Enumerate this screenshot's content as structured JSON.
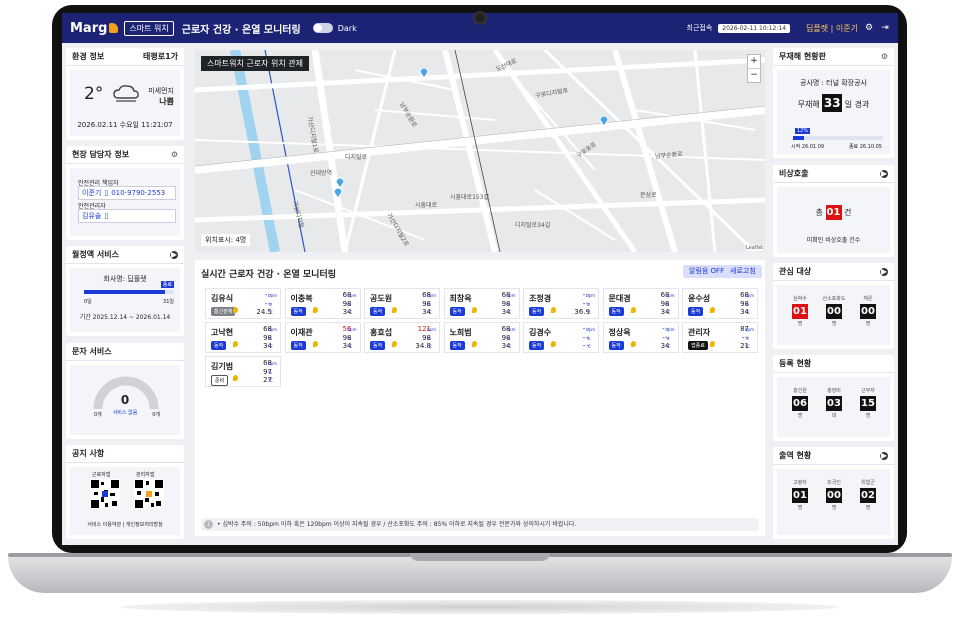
{
  "header": {
    "logo": "Marg",
    "tag": "스마트 워치",
    "title": "근로자 건강 · 온열 모니터링",
    "dark_label": "Dark",
    "last_access_label": "최근접속",
    "last_access_time": "2026-02-11 10:12:14",
    "user": "딥플렛",
    "sep": "|",
    "user2": "이준기"
  },
  "env": {
    "title": "환경 정보",
    "location": "태평로1가",
    "temp": "2°",
    "dust_label": "미세먼지",
    "dust_value": "나쁨",
    "datetime": "2026.02.11 수요일 11:21:07"
  },
  "manager": {
    "title": "현장 담당자 정보",
    "role1": "안전관리 책임자",
    "name1": "이준기",
    "phone1": "010-9790-2553",
    "role2": "안전관리자",
    "name2": "김유술"
  },
  "monthly": {
    "title": "월정액 서비스",
    "company": "회사명: 딥플렛",
    "badge": "종료",
    "start": "0일",
    "end": "31일",
    "progress": 0.9,
    "period": "기간 2025.12.14 ~ 2026.01.14"
  },
  "sms": {
    "title": "문자 서비스",
    "value": "0",
    "min": "0개",
    "max": "0개",
    "label": "서비스 없음"
  },
  "notice": {
    "title": "공지 사항",
    "qr1": "근로자앱",
    "qr2": "관리자앱",
    "links": "서비스 이용약관 | 개인정보처리방침"
  },
  "map": {
    "label": "스마트워치 근로자 위치 관제",
    "count": "위치표시: 4명",
    "zoom_in": "+",
    "zoom_out": "−",
    "attribution": "Leaflet",
    "streets": [
      "도산대로",
      "구로디지털로",
      "남부순환로",
      "가산디지털1로",
      "디지털로",
      "시흥대로",
      "구로동로",
      "신대방역",
      "가산디지털",
      "가산디지털2로",
      "남부순환로",
      "문성로",
      "시흥대로153길",
      "디지털로34길"
    ]
  },
  "monitor": {
    "title": "실시간 근로자 건강 · 온열 모니터링",
    "alarm_btn": "알림음 OFF",
    "refresh_btn": "새로고침",
    "units": {
      "bpm": "bpm",
      "pct": "%",
      "temp": "°C"
    },
    "workers": [
      {
        "name": "김유식",
        "status": "통신장애",
        "color": "#7b7f86",
        "hr": "- -",
        "o2": "- -",
        "temp": "24.5"
      },
      {
        "name": "이충복",
        "status": "동작",
        "color": "#1c3bd6",
        "hr": "68",
        "o2": "98",
        "temp": "34"
      },
      {
        "name": "공도원",
        "status": "동작",
        "color": "#1c3bd6",
        "hr": "68",
        "o2": "98",
        "temp": "34"
      },
      {
        "name": "최창옥",
        "status": "동작",
        "color": "#1c3bd6",
        "hr": "68",
        "o2": "98",
        "temp": "34"
      },
      {
        "name": "조정경",
        "status": "동작",
        "color": "#1c3bd6",
        "hr": "- -",
        "o2": "- -",
        "temp": "36.9"
      },
      {
        "name": "문대경",
        "status": "동작",
        "color": "#1c3bd6",
        "hr": "68",
        "o2": "98",
        "temp": "34"
      },
      {
        "name": "윤수성",
        "status": "동작",
        "color": "#1c3bd6",
        "hr": "68",
        "o2": "98",
        "temp": "34"
      },
      {
        "name": "고낙현",
        "status": "동작",
        "color": "#1c3bd6",
        "hr": "68",
        "o2": "98",
        "temp": "34"
      },
      {
        "name": "이재관",
        "status": "동작",
        "color": "#1c3bd6",
        "hr": "56",
        "o2": "98",
        "temp": "34",
        "hr_alert": true
      },
      {
        "name": "홍효섭",
        "status": "동작",
        "color": "#1c3bd6",
        "hr": "121",
        "o2": "98",
        "temp": "34.8",
        "hr_alert": true
      },
      {
        "name": "노희범",
        "status": "동작",
        "color": "#1c3bd6",
        "hr": "68",
        "o2": "98",
        "temp": "34"
      },
      {
        "name": "김경수",
        "status": "동작",
        "color": "#1c3bd6",
        "hr": "- -",
        "o2": "- -",
        "temp": "- -"
      },
      {
        "name": "정상옥",
        "status": "동작",
        "color": "#1c3bd6",
        "hr": "- -",
        "o2": "- -",
        "temp": "34"
      },
      {
        "name": "관리자",
        "status": "앱종료",
        "color": "#111",
        "hr": "87",
        "o2": "- -",
        "temp": "21"
      },
      {
        "name": "김기범",
        "status": "준비",
        "color": "#fff",
        "hr": "68",
        "o2": "97",
        "temp": "27"
      }
    ],
    "note_p1": "• 심박수 주의 : 50bpm 이하 혹은 120bpm 이상이 지속될 경우 / 산소포화도 주의 : 85% 이하로 지속될 경우 전문가와 상의하시기 바랍니다."
  },
  "accident": {
    "title": "무재해 현황판",
    "project": "공사명 : 터널 확장공사",
    "label": "무재해",
    "days": "33",
    "suffix": "일 경과",
    "pct": "12%",
    "progress": 0.12,
    "start": "시작 26.01.09",
    "end": "종료 26.10.05"
  },
  "emergency": {
    "title": "비상호출",
    "prefix": "총",
    "count": "01",
    "suffix": "건",
    "caption": "미확인 비상호출 건수"
  },
  "watch": {
    "title": "관심 대상",
    "items": [
      {
        "label": "심박수",
        "value": "01",
        "unit": "명",
        "alert": true
      },
      {
        "label": "산소포화도",
        "value": "00",
        "unit": "명"
      },
      {
        "label": "체온",
        "value": "00",
        "unit": "명"
      }
    ]
  },
  "register": {
    "title": "등록 현황",
    "items": [
      {
        "label": "총인원",
        "value": "06",
        "unit": "명"
      },
      {
        "label": "총장비",
        "value": "03",
        "unit": "대"
      },
      {
        "label": "근무자",
        "value": "15",
        "unit": "명"
      }
    ]
  },
  "attendance": {
    "title": "출역 현황",
    "items": [
      {
        "label": "고령자",
        "value": "01",
        "unit": "명"
      },
      {
        "label": "외국인",
        "value": "00",
        "unit": "명"
      },
      {
        "label": "위험군",
        "value": "02",
        "unit": "명"
      }
    ]
  }
}
